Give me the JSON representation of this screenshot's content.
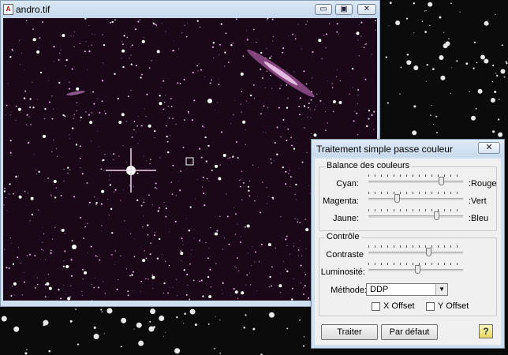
{
  "image_window": {
    "title": "andro.tif",
    "minimize_glyph": "▭",
    "maximize_glyph": "▣",
    "close_glyph": "✕",
    "app_icon_glyph": "A"
  },
  "dialog": {
    "title": "Traitement simple passe couleur",
    "close_glyph": "✕",
    "balance_group": {
      "legend": "Balance des couleurs",
      "rows": [
        {
          "left": "Cyan:",
          "right": ":Rouge",
          "value": 0.77
        },
        {
          "left": "Magenta:",
          "right": ":Vert",
          "value": 0.3
        },
        {
          "left": "Jaune:",
          "right": ":Bleu",
          "value": 0.72
        }
      ]
    },
    "controle_group": {
      "legend": "Contrôle",
      "rows": [
        {
          "left": "Contraste",
          "value": 0.63
        },
        {
          "left": "Luminosité:",
          "value": 0.52
        }
      ],
      "methode_label": "Méthode:",
      "methode_value": "DDP",
      "x_offset_label": "X Offset",
      "y_offset_label": "Y Offset"
    },
    "buttons": {
      "traiter": "Traiter",
      "par_defaut": "Par défaut",
      "help": "?"
    }
  },
  "icons": [
    "app-icon",
    "minimize-icon",
    "maximize-icon",
    "close-icon",
    "dropdown-arrow-icon",
    "help-icon"
  ],
  "colors": {
    "accent": "#cfe0ef",
    "sky": "#1a0818",
    "star": "#f2c8f0"
  }
}
